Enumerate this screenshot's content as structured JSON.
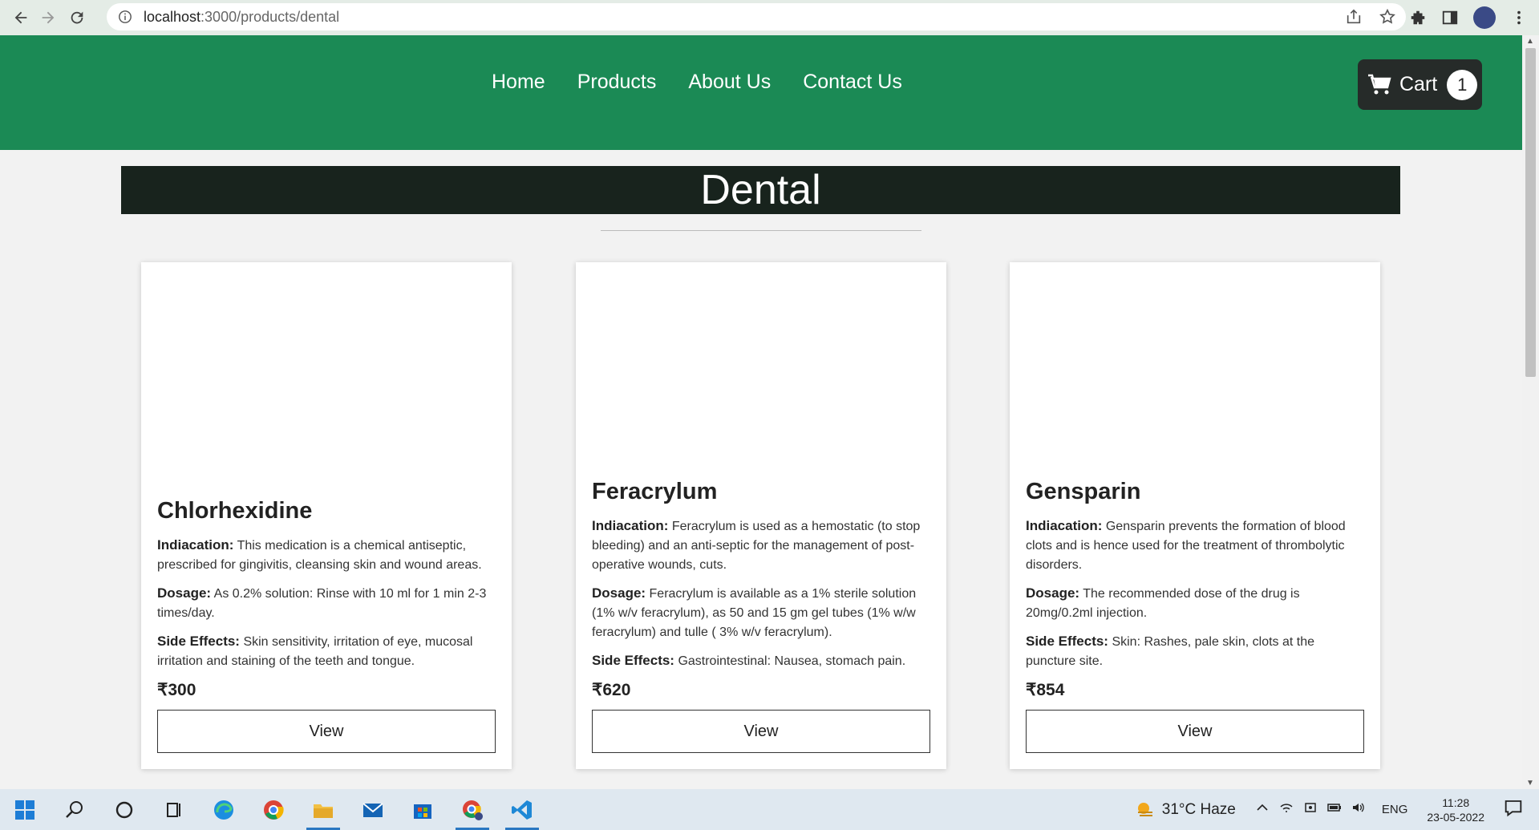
{
  "browser": {
    "url_host": "localhost",
    "url_path": ":3000/products/dental"
  },
  "nav": {
    "items": [
      "Home",
      "Products",
      "About Us",
      "Contact Us"
    ],
    "cart_label": "Cart",
    "cart_count": "1",
    "brand_color": "#1b8a55"
  },
  "page": {
    "heading": "Dental"
  },
  "labels": {
    "indication": "Indiacation:",
    "dosage": "Dosage:",
    "side_effects": "Side Effects:",
    "view": "View"
  },
  "products": [
    {
      "name": "Chlorhexidine",
      "indication": "This medication is a chemical antiseptic, prescribed for gingivitis, cleansing skin and wound areas.",
      "dosage": "As 0.2% solution: Rinse with 10 ml for 1 min 2-3 times/day.",
      "side_effects": "Skin sensitivity, irritation of eye, mucosal irritation and staining of the teeth and tongue.",
      "price": "₹300"
    },
    {
      "name": "Feracrylum",
      "indication": "Feracrylum is used as a hemostatic (to stop bleeding) and an anti-septic for the management of post-operative wounds, cuts.",
      "dosage": "Feracrylum is available as a 1% sterile solution (1% w/v feracrylum), as 50 and 15 gm gel tubes (1% w/w feracrylum) and tulle ( 3% w/v feracrylum).",
      "side_effects": "Gastrointestinal: Nausea, stomach pain.",
      "price": "₹620"
    },
    {
      "name": "Gensparin",
      "indication": "Gensparin prevents the formation of blood clots and is hence used for the treatment of thrombolytic disorders.",
      "dosage": "The recommended dose of the drug is 20mg/0.2ml injection.",
      "side_effects": "Skin: Rashes, pale skin, clots at the puncture site.",
      "price": "₹854"
    }
  ],
  "taskbar": {
    "weather": "31°C  Haze",
    "language": "ENG",
    "time": "11:28",
    "date": "23-05-2022"
  }
}
